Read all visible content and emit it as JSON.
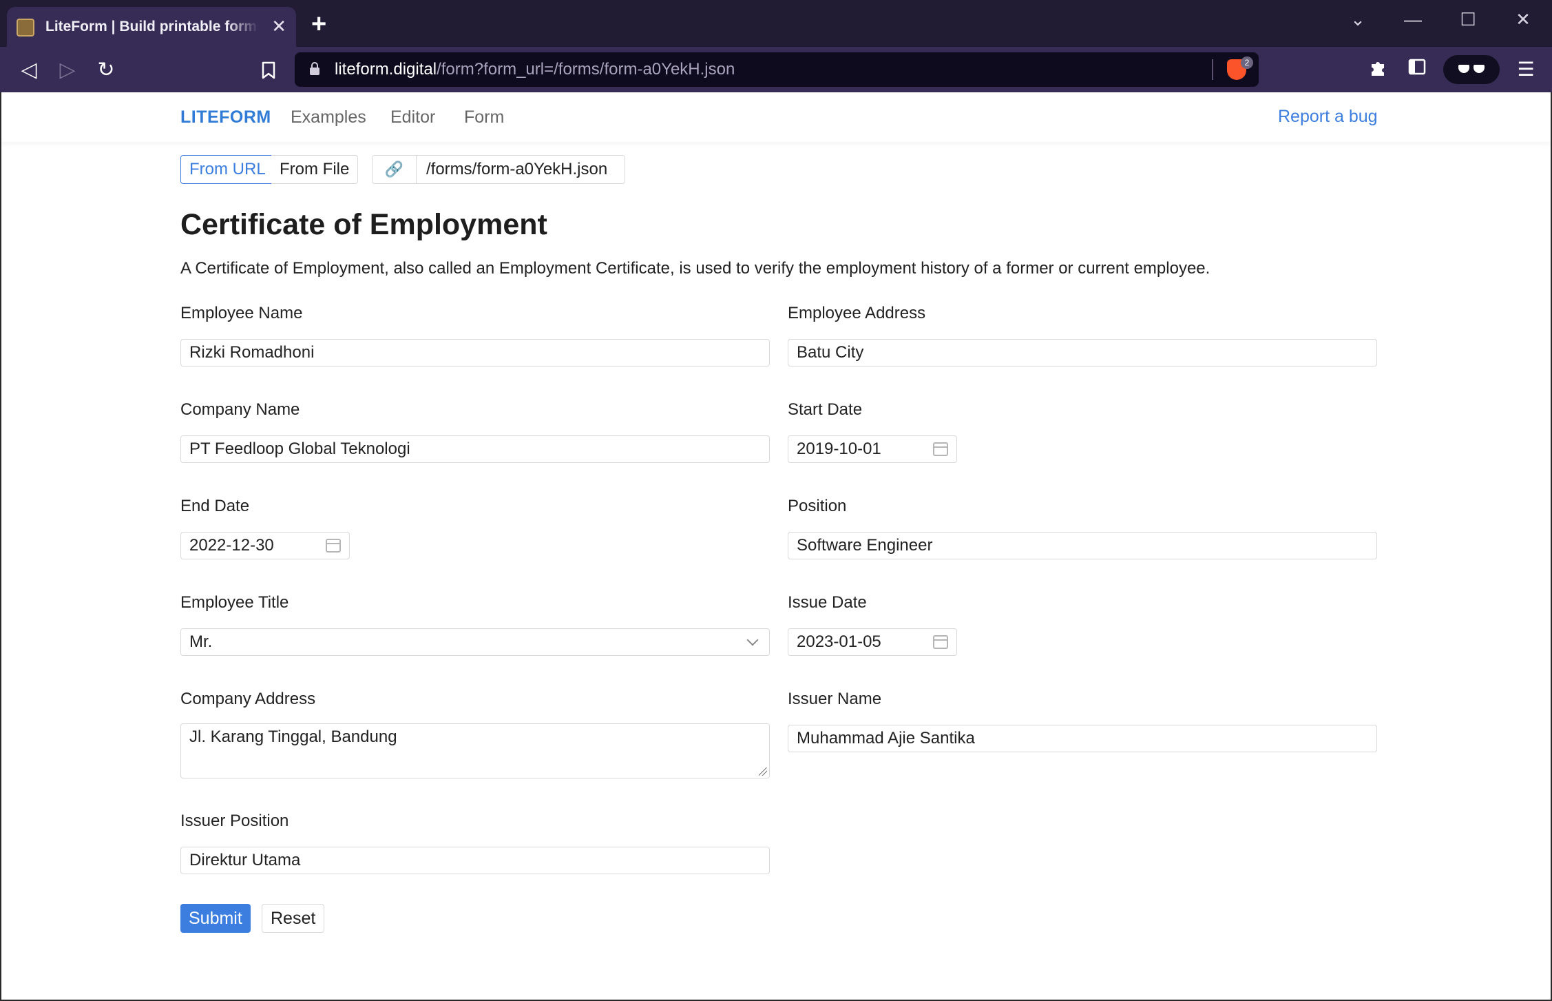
{
  "browser": {
    "tab_title": "LiteForm | Build printable forms with JSON",
    "tab_close": "✕",
    "new_tab": "+",
    "url_host": "liteform.digital",
    "url_path": "/form?form_url=/forms/form-a0YekH.json",
    "shield_badge": "2",
    "icons": {
      "back": "◁",
      "forward": "▷",
      "reload": "↻",
      "bookmark": "bookmark-icon",
      "extensions": "puzzle-icon",
      "sidebar": "sidebar-icon",
      "menu": "☰",
      "minimize": "—",
      "maximize": "☐",
      "close": "✕",
      "tabs_dropdown": "⌄"
    }
  },
  "site_nav": {
    "brand": "LITEFORM",
    "links": [
      "Examples",
      "Editor",
      "Form"
    ],
    "report_bug": "Report a bug"
  },
  "source": {
    "from_url": "From URL",
    "from_file": "From File",
    "active": "From URL",
    "link_icon": "🔗",
    "path": "/forms/form-a0YekH.json"
  },
  "form": {
    "title": "Certificate of Employment",
    "description": "A Certificate of Employment, also called an Employment Certificate, is used to verify the employment history of a former or current employee.",
    "fields": {
      "employee_name": {
        "label": "Employee Name",
        "value": "Rizki Romadhoni"
      },
      "employee_address": {
        "label": "Employee Address",
        "value": "Batu City"
      },
      "company_name": {
        "label": "Company Name",
        "value": "PT Feedloop Global Teknologi"
      },
      "start_date": {
        "label": "Start Date",
        "value": "2019-10-01"
      },
      "end_date": {
        "label": "End Date",
        "value": "2022-12-30"
      },
      "position": {
        "label": "Position",
        "value": "Software Engineer"
      },
      "employee_title": {
        "label": "Employee Title",
        "value": "Mr."
      },
      "issue_date": {
        "label": "Issue Date",
        "value": "2023-01-05"
      },
      "company_address": {
        "label": "Company Address",
        "value": "Jl. Karang Tinggal, Bandung"
      },
      "issuer_name": {
        "label": "Issuer Name",
        "value": "Muhammad Ajie Santika"
      },
      "issuer_position": {
        "label": "Issuer Position",
        "value": "Direktur Utama"
      }
    },
    "submit": "Submit",
    "reset": "Reset"
  },
  "colors": {
    "accent": "#3b7ee0",
    "brand": "#2f7bd6",
    "chrome_dark": "#211b33",
    "chrome_toolbar": "#362c56",
    "brave_orange": "#fb542b"
  }
}
